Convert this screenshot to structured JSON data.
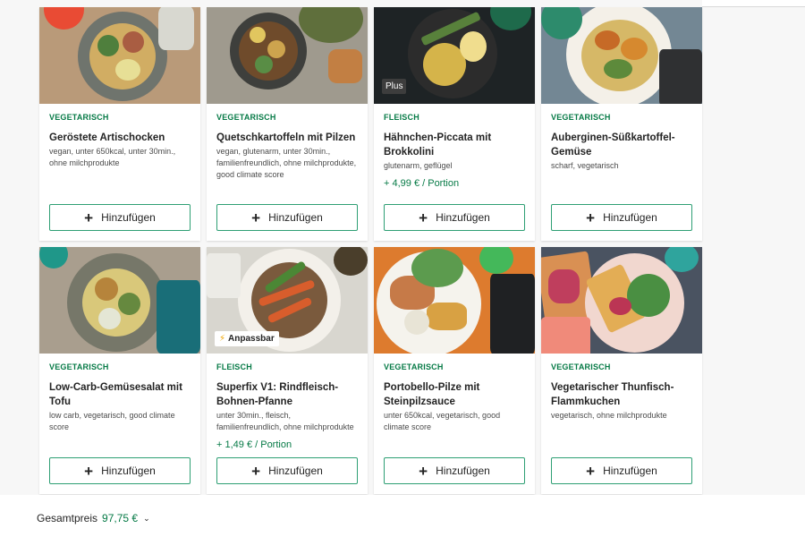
{
  "cards": [
    {
      "category": "VEGETARISCH",
      "title": "Geröstete Artischocken",
      "tags": "vegan, unter 650kcal, unter 30min., ohne milchprodukte",
      "price": "",
      "badge": "",
      "add_label": "Hinzufügen",
      "image_icon": "recipe-photo"
    },
    {
      "category": "VEGETARISCH",
      "title": "Quetschkartoffeln mit Pilzen",
      "tags": "vegan, glutenarm, unter 30min., familienfreundlich, ohne milchprodukte, good climate score",
      "price": "",
      "badge": "",
      "add_label": "Hinzufügen",
      "image_icon": "recipe-photo"
    },
    {
      "category": "FLEISCH",
      "title": "Hähnchen-Piccata mit Brokkolini",
      "tags": "glutenarm, geflügel",
      "price": "+ 4,99 € / Portion",
      "badge": "Plus",
      "add_label": "Hinzufügen",
      "image_icon": "recipe-photo"
    },
    {
      "category": "VEGETARISCH",
      "title": "Auberginen-Süßkartoffel-Gemüse",
      "tags": "scharf, vegetarisch",
      "price": "",
      "badge": "",
      "add_label": "Hinzufügen",
      "image_icon": "recipe-photo"
    },
    {
      "category": "VEGETARISCH",
      "title": "Low-Carb-Gemüsesalat mit Tofu",
      "tags": "low carb, vegetarisch, good climate score",
      "price": "",
      "badge": "",
      "add_label": "Hinzufügen",
      "image_icon": "recipe-photo"
    },
    {
      "category": "FLEISCH",
      "title": "Superfix V1: Rindfleisch-Bohnen-Pfanne",
      "tags": "unter 30min., fleisch, familienfreundlich, ohne milchprodukte",
      "price": "+ 1,49 € / Portion",
      "badge": "Anpassbar",
      "add_label": "Hinzufügen",
      "image_icon": "recipe-photo"
    },
    {
      "category": "VEGETARISCH",
      "title": "Portobello-Pilze mit Steinpilzsauce",
      "tags": "unter 650kcal, vegetarisch, good climate score",
      "price": "",
      "badge": "",
      "add_label": "Hinzufügen",
      "image_icon": "recipe-photo"
    },
    {
      "category": "VEGETARISCH",
      "title": "Vegetarischer Thunfisch-Flammkuchen",
      "tags": "vegetarisch, ohne milchprodukte",
      "price": "",
      "badge": "",
      "add_label": "Hinzufügen",
      "image_icon": "recipe-photo"
    }
  ],
  "footer": {
    "total_label": "Gesamtpreis",
    "total_value": "97,75 €",
    "chevron_icon": "chevron-down-icon"
  },
  "colors": {
    "accent_green": "#067a46",
    "button_border": "#2e9f74",
    "background": "#f7f7f7"
  }
}
